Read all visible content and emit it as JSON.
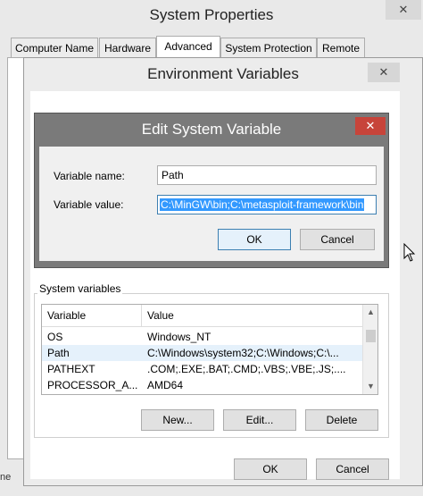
{
  "system_properties": {
    "title": "System Properties",
    "close_glyph": "✕",
    "tabs": [
      {
        "label": "Computer Name",
        "active": false
      },
      {
        "label": "Hardware",
        "active": false
      },
      {
        "label": "Advanced",
        "active": true
      },
      {
        "label": "System Protection",
        "active": false
      },
      {
        "label": "Remote",
        "active": false
      }
    ],
    "left_edge_text": "ne"
  },
  "environment_variables": {
    "title": "Environment Variables",
    "close_glyph": "✕",
    "system_variables": {
      "group_label": "System variables",
      "columns": [
        "Variable",
        "Value"
      ],
      "rows": [
        {
          "variable": "OS",
          "value": "Windows_NT",
          "selected": false
        },
        {
          "variable": "Path",
          "value": "C:\\Windows\\system32;C:\\Windows;C:\\...",
          "selected": true
        },
        {
          "variable": "PATHEXT",
          "value": ".COM;.EXE;.BAT;.CMD;.VBS;.VBE;.JS;....",
          "selected": false
        },
        {
          "variable": "PROCESSOR_A...",
          "value": "AMD64",
          "selected": false
        }
      ],
      "new_label": "New...",
      "edit_label": "Edit...",
      "delete_label": "Delete"
    },
    "ok_label": "OK",
    "cancel_label": "Cancel"
  },
  "edit_dialog": {
    "title": "Edit System Variable",
    "close_glyph": "✕",
    "variable_name_label": "Variable name:",
    "variable_name_value": "Path",
    "variable_value_label": "Variable value:",
    "variable_value_value": "C:\\MinGW\\bin;C:\\metasploit-framework\\bin",
    "ok_label": "OK",
    "cancel_label": "Cancel"
  },
  "colors": {
    "selection_blue": "#3399ff",
    "close_red": "#c7443a",
    "dialog_frame": "#7a7a7a"
  }
}
